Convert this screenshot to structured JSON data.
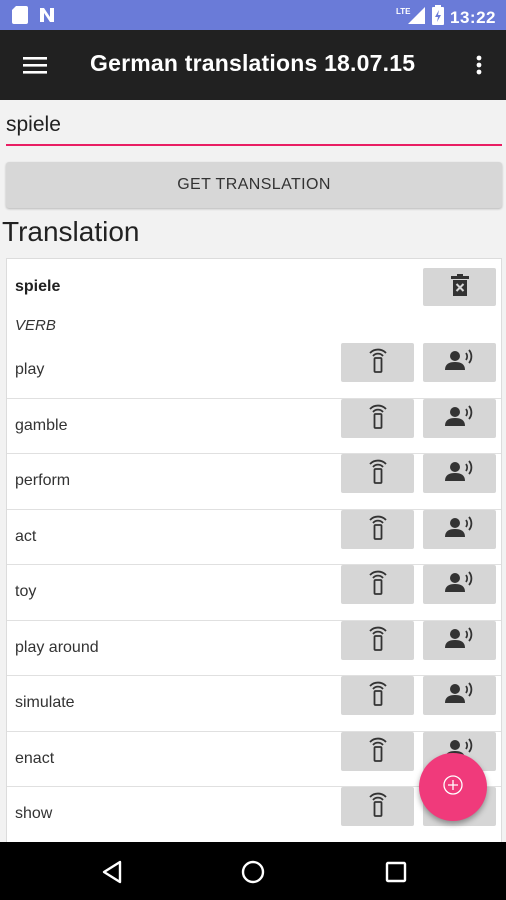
{
  "status_bar": {
    "time": "13:22",
    "network": "LTE"
  },
  "app_bar": {
    "title": "German translations 18.07.15"
  },
  "search": {
    "value": "spiele"
  },
  "get_translation_label": "GET TRANSLATION",
  "section_title": "Translation",
  "entry": {
    "word": "spiele",
    "part_of_speech": "VERB",
    "translations": [
      "play",
      "gamble",
      "perform",
      "act",
      "toy",
      "play around",
      "simulate",
      "enact",
      "show"
    ]
  },
  "colors": {
    "accent": "#e91e63",
    "fab": "#f03a7b",
    "status_bar": "#6a7bd8",
    "app_bar": "#212121"
  }
}
